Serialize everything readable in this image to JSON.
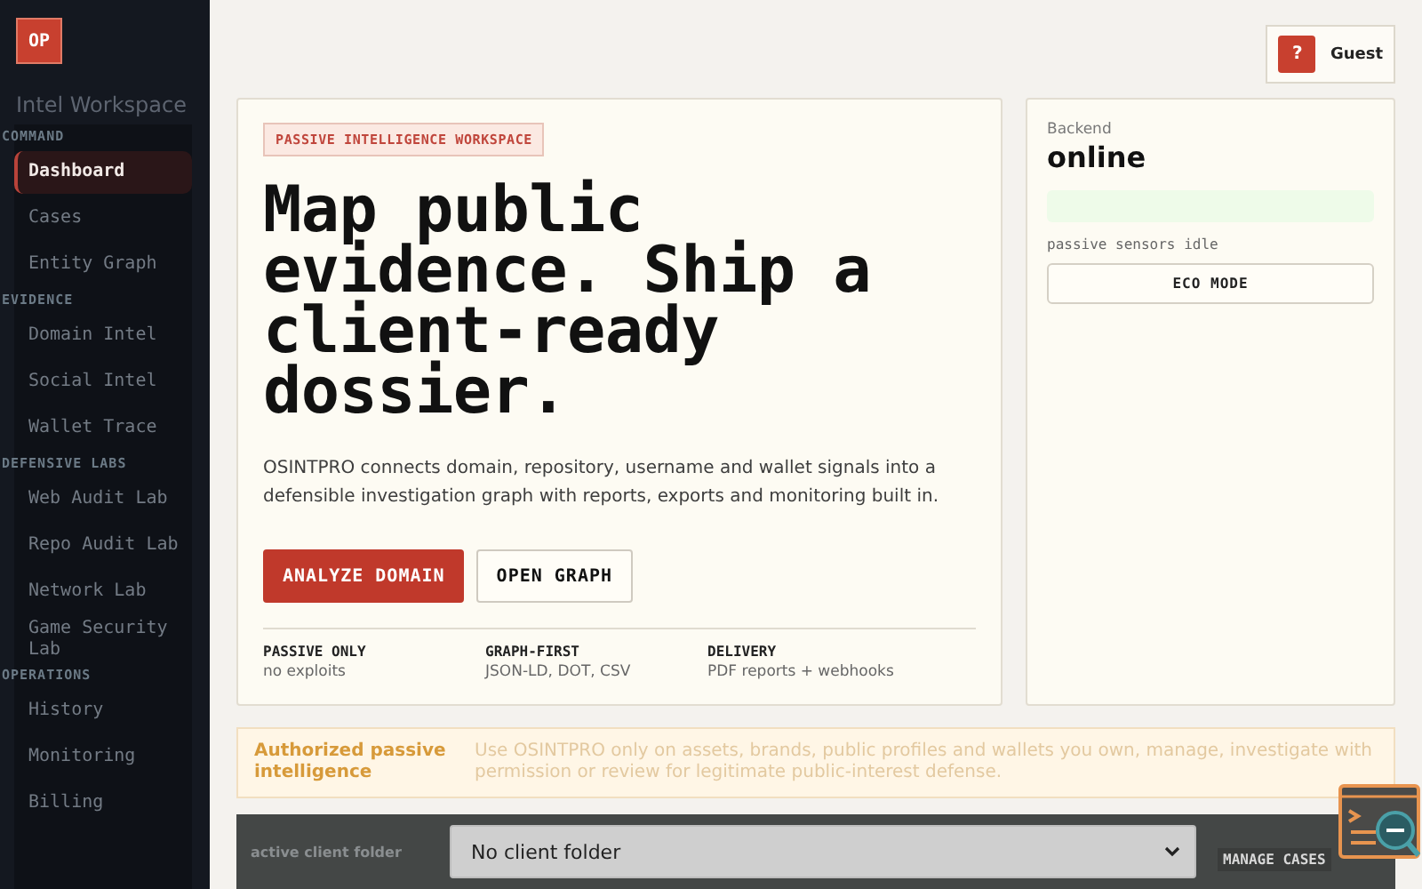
{
  "brand": {
    "logo": "OP",
    "subtitle": "Intel Workspace"
  },
  "nav": [
    {
      "heading": "COMMAND",
      "items": [
        {
          "label": "Dashboard",
          "selected": true
        },
        {
          "label": "Cases",
          "selected": false
        },
        {
          "label": "Entity Graph",
          "selected": false
        }
      ]
    },
    {
      "heading": "EVIDENCE",
      "items": [
        {
          "label": "Domain Intel",
          "selected": false
        },
        {
          "label": "Social Intel",
          "selected": false
        },
        {
          "label": "Wallet Trace",
          "selected": false
        }
      ]
    },
    {
      "heading": "DEFENSIVE LABS",
      "items": [
        {
          "label": "Web Audit Lab",
          "selected": false
        },
        {
          "label": "Repo Audit Lab",
          "selected": false
        },
        {
          "label": "Network Lab",
          "selected": false
        },
        {
          "label": "Game Security Lab",
          "selected": false
        }
      ]
    },
    {
      "heading": "OPERATIONS",
      "items": [
        {
          "label": "History",
          "selected": false
        },
        {
          "label": "Monitoring",
          "selected": false
        },
        {
          "label": "Billing",
          "selected": false
        }
      ]
    }
  ],
  "user": {
    "avatar": "?",
    "name": "Guest"
  },
  "hero": {
    "badge": "PASSIVE INTELLIGENCE WORKSPACE",
    "title": "Map public evidence. Ship a client-ready dossier.",
    "description": "OSINTPRO connects domain, repository, username and wallet signals into a defensible investigation graph with reports, exports and monitoring built in.",
    "buttons": [
      {
        "label": "ANALYZE DOMAIN",
        "kind": "primary"
      },
      {
        "label": "OPEN GRAPH",
        "kind": "secondary"
      }
    ],
    "features": [
      {
        "title": "PASSIVE ONLY",
        "detail": "no exploits"
      },
      {
        "title": "GRAPH-FIRST",
        "detail": "JSON-LD, DOT, CSV"
      },
      {
        "title": "DELIVERY",
        "detail": "PDF reports + webhooks"
      }
    ]
  },
  "status": {
    "label": "Backend",
    "value": "online",
    "note": "passive sensors idle",
    "button": "ECO MODE"
  },
  "notice": {
    "title": "Authorized passive intelligence",
    "text": "Use OSINTPRO only on assets, brands, public profiles and wallets you own, manage, investigate with permission or review for legitimate public-interest defense."
  },
  "client_bar": {
    "label": "active client folder",
    "select_value": "No client folder",
    "button": "MANAGE CASES"
  }
}
